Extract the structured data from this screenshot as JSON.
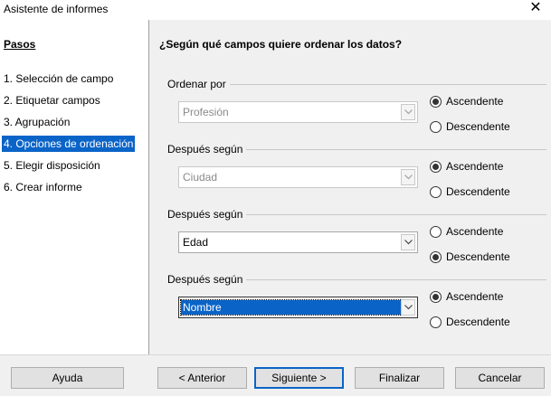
{
  "window": {
    "title": "Asistente de informes",
    "close_glyph": "✕"
  },
  "steps": {
    "heading": "Pasos",
    "items": [
      "1. Selección de campo",
      "2. Etiquetar campos",
      "3. Agrupación",
      "4. Opciones de ordenación",
      "5. Elegir disposición",
      "6. Crear informe"
    ],
    "active_index": 3
  },
  "main": {
    "question": "¿Según qué campos quiere ordenar los datos?",
    "groups": [
      {
        "label": "Ordenar por",
        "value": "Profesión",
        "disabled": true,
        "ascending_label": "Ascendente",
        "descending_label": "Descendente",
        "selected": "ascending"
      },
      {
        "label": "Después según",
        "value": "Ciudad",
        "disabled": true,
        "ascending_label": "Ascendente",
        "descending_label": "Descendente",
        "selected": "ascending"
      },
      {
        "label": "Después según",
        "value": "Edad",
        "disabled": false,
        "ascending_label": "Ascendente",
        "descending_label": "Descendente",
        "selected": "descending"
      },
      {
        "label": "Después según",
        "value": "Nombre",
        "disabled": false,
        "focused": true,
        "ascending_label": "Ascendente",
        "descending_label": "Descendente",
        "selected": "ascending"
      }
    ]
  },
  "buttons": {
    "help": "Ayuda",
    "back": "< Anterior",
    "next": "Siguiente >",
    "finish": "Finalizar",
    "cancel": "Cancelar"
  }
}
